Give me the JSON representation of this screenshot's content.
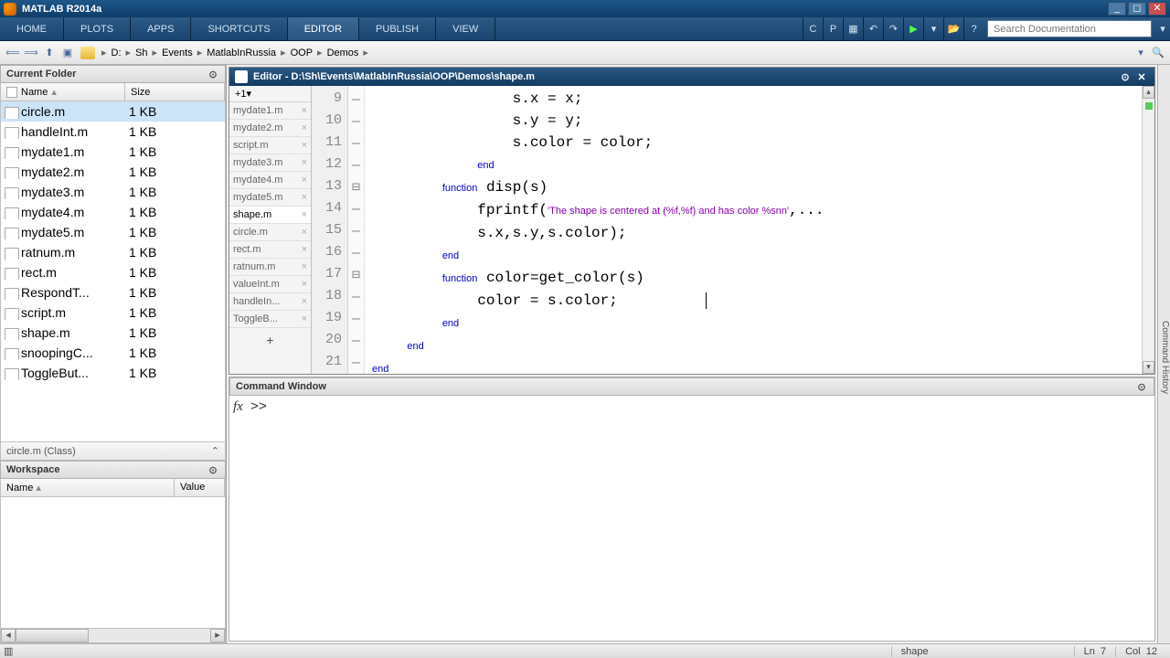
{
  "app": {
    "title": "MATLAB R2014a"
  },
  "toolstrip": {
    "tabs": [
      "HOME",
      "PLOTS",
      "APPS",
      "SHORTCUTS",
      "EDITOR",
      "PUBLISH",
      "VIEW"
    ],
    "active": 4,
    "search_placeholder": "Search Documentation"
  },
  "path": {
    "crumbs": [
      "D:",
      "Sh",
      "Events",
      "MatlabInRussia",
      "OOP",
      "Demos"
    ]
  },
  "current_folder": {
    "title": "Current Folder",
    "cols": {
      "name": "Name",
      "size": "Size"
    },
    "files": [
      {
        "name": "circle.m",
        "size": "1 KB"
      },
      {
        "name": "handleInt.m",
        "size": "1 KB"
      },
      {
        "name": "mydate1.m",
        "size": "1 KB"
      },
      {
        "name": "mydate2.m",
        "size": "1 KB"
      },
      {
        "name": "mydate3.m",
        "size": "1 KB"
      },
      {
        "name": "mydate4.m",
        "size": "1 KB"
      },
      {
        "name": "mydate5.m",
        "size": "1 KB"
      },
      {
        "name": "ratnum.m",
        "size": "1 KB"
      },
      {
        "name": "rect.m",
        "size": "1 KB"
      },
      {
        "name": "RespondT...",
        "size": "1 KB"
      },
      {
        "name": "script.m",
        "size": "1 KB"
      },
      {
        "name": "shape.m",
        "size": "1 KB"
      },
      {
        "name": "snoopingC...",
        "size": "1 KB"
      },
      {
        "name": "ToggleBut...",
        "size": "1 KB"
      }
    ],
    "selected": 0,
    "detail": "circle.m (Class)"
  },
  "workspace": {
    "title": "Workspace",
    "cols": {
      "name": "Name",
      "value": "Value"
    }
  },
  "editor": {
    "title": "Editor - D:\\Sh\\Events\\MatlabInRussia\\OOP\\Demos\\shape.m",
    "plus_label": "+1",
    "tabs": [
      {
        "label": "mydate1.m"
      },
      {
        "label": "mydate2.m"
      },
      {
        "label": "script.m"
      },
      {
        "label": "mydate3.m"
      },
      {
        "label": "mydate4.m"
      },
      {
        "label": "mydate5.m"
      },
      {
        "label": "shape.m"
      },
      {
        "label": "circle.m"
      },
      {
        "label": "rect.m"
      },
      {
        "label": "ratnum.m"
      },
      {
        "label": "valueInt.m"
      },
      {
        "label": "handleIn..."
      },
      {
        "label": "ToggleB..."
      }
    ],
    "active_tab": 6,
    "first_line": 9,
    "lines": [
      {
        "indent": "                ",
        "pre": "s.x = x;"
      },
      {
        "indent": "                ",
        "pre": "s.y = y;"
      },
      {
        "indent": "                ",
        "pre": "s.color = color;"
      },
      {
        "indent": "            ",
        "kw": "end"
      },
      {
        "indent": "        ",
        "kw": "function",
        "rest": " disp(s)"
      },
      {
        "indent": "            ",
        "pre": "fprintf(",
        "str": "'The shape is centered at (%f,%f) and has color %snn'",
        "post": ",..."
      },
      {
        "indent": "            ",
        "pre": "s.x,s.y,s.color);"
      },
      {
        "indent": "        ",
        "kw": "end"
      },
      {
        "indent": "        ",
        "kw": "function",
        "rest": " color=get_color(s)"
      },
      {
        "indent": "            ",
        "pre": "color = s.color;          ",
        "cursor": true
      },
      {
        "indent": "        ",
        "kw": "end"
      },
      {
        "indent": "    ",
        "kw": "end"
      },
      {
        "indent": "",
        "kw": "end"
      }
    ]
  },
  "command": {
    "title": "Command Window",
    "prompt": ">>",
    "fx": "fx"
  },
  "status": {
    "func": "shape",
    "ln_label": "Ln",
    "ln": "7",
    "col_label": "Col",
    "col": "12"
  },
  "sidebar": {
    "label": "Command History"
  }
}
